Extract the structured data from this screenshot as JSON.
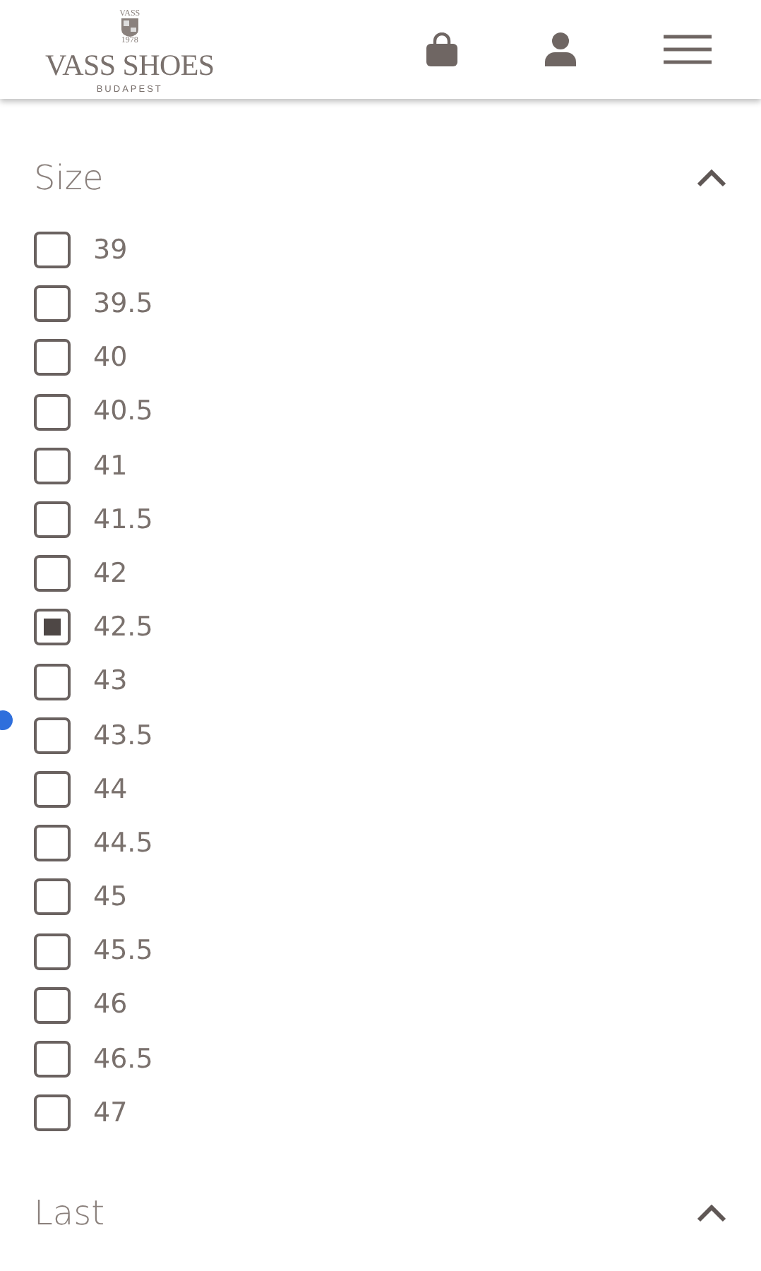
{
  "header": {
    "logo": {
      "top": "VASS",
      "year": "1978",
      "name": "VASS SHOES",
      "city": "BUDAPEST"
    }
  },
  "filters": [
    {
      "title": "Size",
      "expanded": true,
      "options": [
        {
          "label": "39",
          "checked": false
        },
        {
          "label": "39.5",
          "checked": false
        },
        {
          "label": "40",
          "checked": false
        },
        {
          "label": "40.5",
          "checked": false
        },
        {
          "label": "41",
          "checked": false
        },
        {
          "label": "41.5",
          "checked": false
        },
        {
          "label": "42",
          "checked": false
        },
        {
          "label": "42.5",
          "checked": true
        },
        {
          "label": "43",
          "checked": false
        },
        {
          "label": "43.5",
          "checked": false
        },
        {
          "label": "44",
          "checked": false
        },
        {
          "label": "44.5",
          "checked": false
        },
        {
          "label": "45",
          "checked": false
        },
        {
          "label": "45.5",
          "checked": false
        },
        {
          "label": "46",
          "checked": false
        },
        {
          "label": "46.5",
          "checked": false
        },
        {
          "label": "47",
          "checked": false
        }
      ]
    },
    {
      "title": "Last",
      "expanded": true
    }
  ]
}
